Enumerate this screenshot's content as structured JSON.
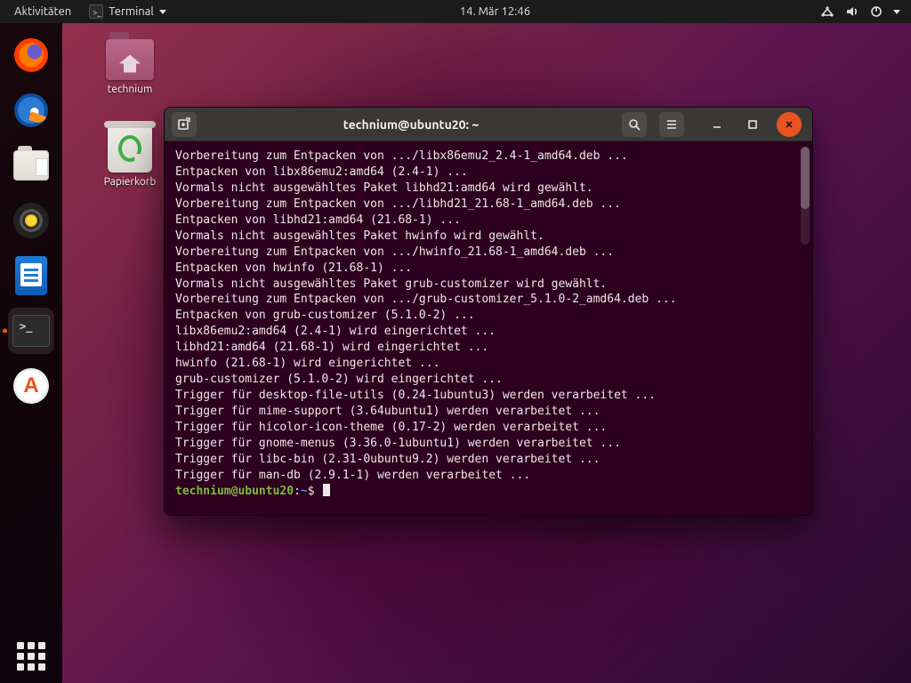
{
  "top_panel": {
    "activities": "Aktivitäten",
    "app_menu_label": "Terminal",
    "clock": "14. Mär  12:46"
  },
  "desktop_icons": {
    "home_label": "technium",
    "trash_label": "Papierkorb"
  },
  "dock": {
    "items": [
      {
        "name": "firefox"
      },
      {
        "name": "thunderbird"
      },
      {
        "name": "files"
      },
      {
        "name": "rhythmbox"
      },
      {
        "name": "writer"
      },
      {
        "name": "terminal"
      },
      {
        "name": "software-updater"
      }
    ]
  },
  "terminal": {
    "title": "technium@ubuntu20: ~",
    "prompt": {
      "user": "technium@ubuntu20",
      "sep": ":",
      "path": "~",
      "dollar": "$"
    },
    "lines": [
      "Vorbereitung zum Entpacken von .../libx86emu2_2.4-1_amd64.deb ...",
      "Entpacken von libx86emu2:amd64 (2.4-1) ...",
      "Vormals nicht ausgewähltes Paket libhd21:amd64 wird gewählt.",
      "Vorbereitung zum Entpacken von .../libhd21_21.68-1_amd64.deb ...",
      "Entpacken von libhd21:amd64 (21.68-1) ...",
      "Vormals nicht ausgewähltes Paket hwinfo wird gewählt.",
      "Vorbereitung zum Entpacken von .../hwinfo_21.68-1_amd64.deb ...",
      "Entpacken von hwinfo (21.68-1) ...",
      "Vormals nicht ausgewähltes Paket grub-customizer wird gewählt.",
      "Vorbereitung zum Entpacken von .../grub-customizer_5.1.0-2_amd64.deb ...",
      "Entpacken von grub-customizer (5.1.0-2) ...",
      "libx86emu2:amd64 (2.4-1) wird eingerichtet ...",
      "libhd21:amd64 (21.68-1) wird eingerichtet ...",
      "hwinfo (21.68-1) wird eingerichtet ...",
      "grub-customizer (5.1.0-2) wird eingerichtet ...",
      "Trigger für desktop-file-utils (0.24-1ubuntu3) werden verarbeitet ...",
      "Trigger für mime-support (3.64ubuntu1) werden verarbeitet ...",
      "Trigger für hicolor-icon-theme (0.17-2) werden verarbeitet ...",
      "Trigger für gnome-menus (3.36.0-1ubuntu1) werden verarbeitet ...",
      "Trigger für libc-bin (2.31-0ubuntu9.2) werden verarbeitet ...",
      "Trigger für man-db (2.9.1-1) werden verarbeitet ..."
    ]
  }
}
